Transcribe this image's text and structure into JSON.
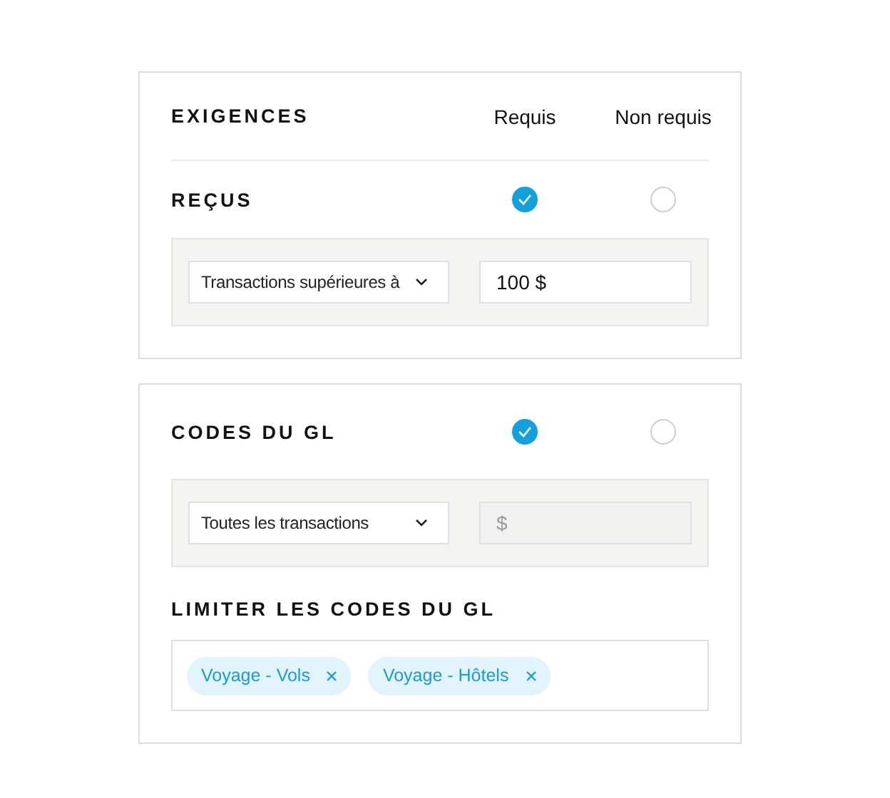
{
  "header": {
    "title": "EXIGENCES",
    "columns": [
      "Requis",
      "Non requis"
    ]
  },
  "sections": [
    {
      "title": "REÇUS",
      "options": [
        {
          "selected": true
        },
        {
          "selected": false
        }
      ],
      "condition": {
        "value": "Transactions supérieures à"
      },
      "amount": {
        "value": "100 $",
        "disabled": false
      }
    },
    {
      "title": "CODES DU GL",
      "options": [
        {
          "selected": true
        },
        {
          "selected": false
        }
      ],
      "condition": {
        "value": "Toutes les transactions"
      },
      "amount": {
        "placeholder": "$",
        "disabled": true
      },
      "limit": {
        "title": "LIMITER LES CODES DU GL",
        "tags": [
          {
            "label": "Voyage - Vols"
          },
          {
            "label": "Voyage - Hôtels"
          }
        ]
      }
    }
  ]
}
